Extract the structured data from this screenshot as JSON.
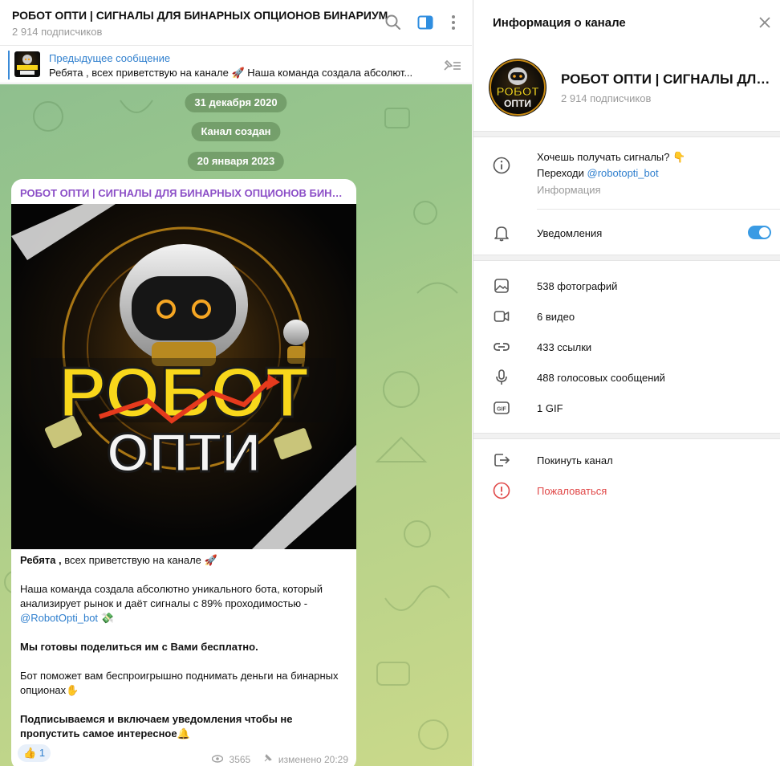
{
  "chat": {
    "title": "РОБОТ ОПТИ | СИГНАЛЫ ДЛЯ БИНАРНЫХ ОПЦИОНОВ БИНАРИУМ",
    "subscribers": "2 914 подписчиков",
    "icons": [
      "search-icon",
      "sidebar-toggle-icon",
      "more-vertical-icon"
    ],
    "pinned": {
      "label": "Предыдущее сообщение",
      "text": "Ребята , всех приветствую на канале 🚀  Наша команда создала абсолют..."
    },
    "dates": [
      "31 декабря 2020",
      "Канал создан",
      "20 января 2023"
    ],
    "post": {
      "channel": "РОБОТ ОПТИ | СИГНАЛЫ ДЛЯ БИНАРНЫХ ОПЦИОНОВ БИНАР...",
      "image_text": {
        "line1": "РОБОТ",
        "line2": "ОПТИ"
      },
      "line1_bold": "Ребята ,",
      "line1_rest": " всех приветствую на канале 🚀",
      "p2": "Наша команда создала абсолютно уникального бота, который анализирует рынок и даёт сигналы с 89% проходимостью -",
      "link": "@RobotOpti_bot",
      "link_emoji": " 💸",
      "p3": "Мы готовы поделиться им с Вами бесплатно.",
      "p4": "Бот поможет вам беспроигрышно поднимать деньги на бинарных опционах✋",
      "p5": "Подписываемся и включаем уведомления чтобы не пропустить самое интересное🔔",
      "reaction_emoji": "👍",
      "reaction_count": "1",
      "views": "3565",
      "edited": "изменено 20:29"
    }
  },
  "info": {
    "title": "Информация о канале",
    "channel_name": "РОБОТ ОПТИ | СИГНАЛЫ ДЛЯ ...",
    "avatar_text": {
      "line1": "РОБОТ",
      "line2": "ОПТИ"
    },
    "subscribers": "2 914 подписчиков",
    "about_line1": "Хочешь получать сигналы? 👇",
    "about_line2_prefix": "Переходи ",
    "about_link": "@robotopti_bot",
    "about_caption": "Информация",
    "notifications_label": "Уведомления",
    "notifications_on": true,
    "media": [
      {
        "icon": "photo-icon",
        "label": "538 фотографий"
      },
      {
        "icon": "video-icon",
        "label": "6 видео"
      },
      {
        "icon": "link-icon",
        "label": "433 ссылки"
      },
      {
        "icon": "microphone-icon",
        "label": "488 голосовых сообщений"
      },
      {
        "icon": "gif-icon",
        "label": "1 GIF"
      }
    ],
    "leave_label": "Покинуть канал",
    "report_label": "Пожаловаться"
  },
  "colors": {
    "accent": "#3a8ad8",
    "channel_name": "#8c4fc7",
    "danger": "#e04747",
    "toggle": "#3a9be4"
  }
}
